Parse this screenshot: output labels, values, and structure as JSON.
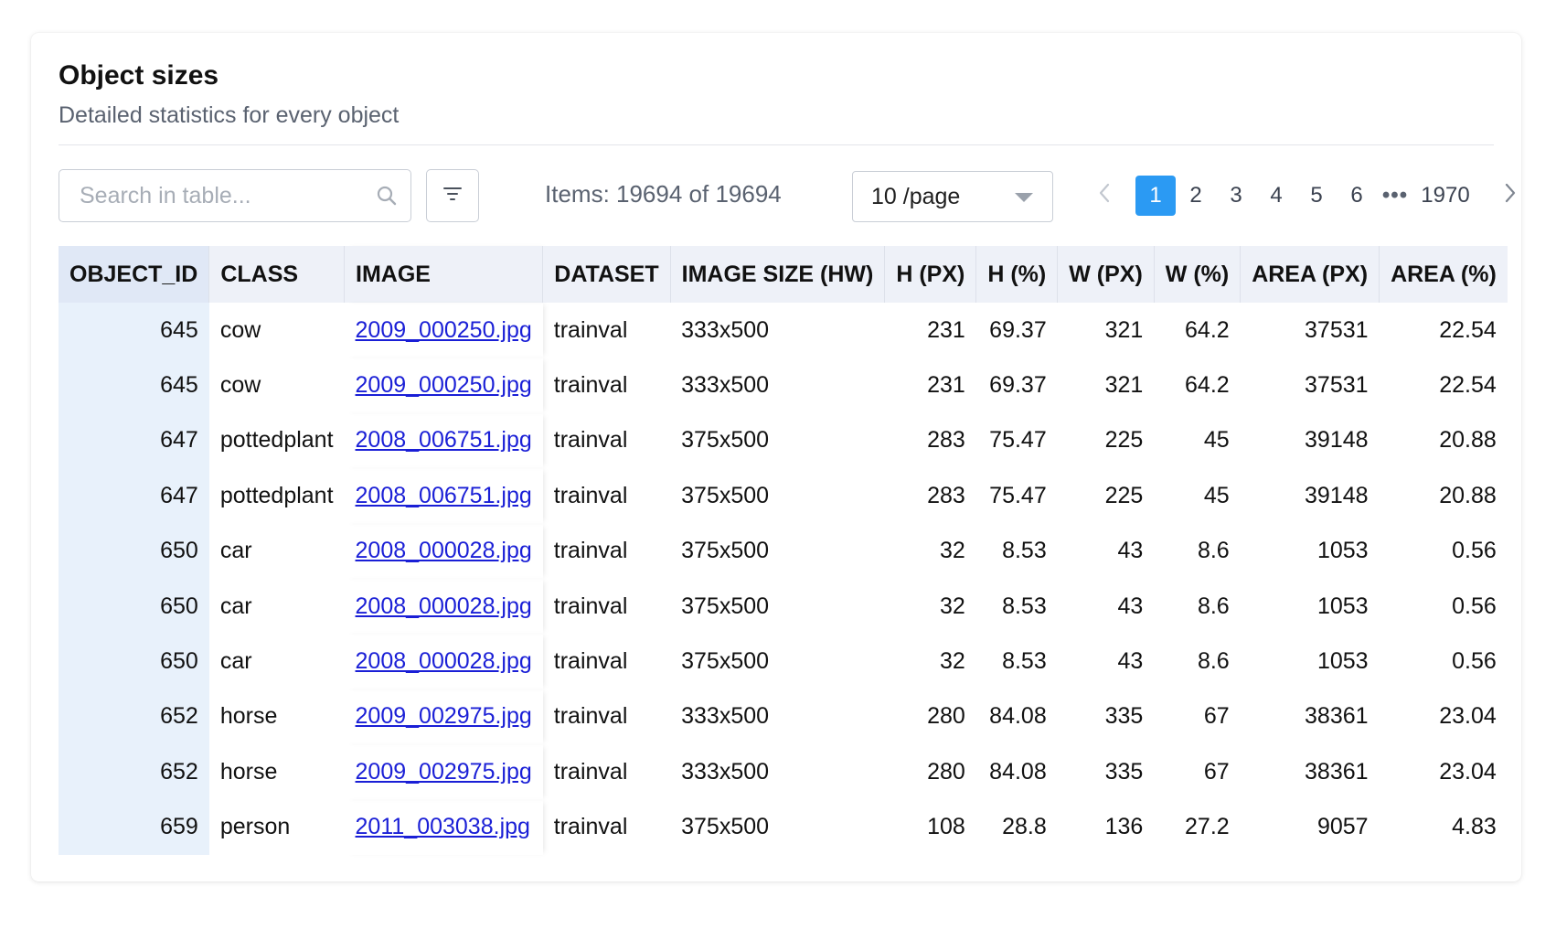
{
  "card": {
    "title": "Object sizes",
    "subtitle": "Detailed statistics for every object"
  },
  "toolbar": {
    "search_placeholder": "Search in table...",
    "search_icon": "search-icon",
    "filter_icon": "filter-icon",
    "items_text": "Items: 19694 of 19694",
    "page_size_label": "10 /page",
    "page_size_icon": "caret-down-icon"
  },
  "pagination": {
    "prev_icon": "chevron-left-icon",
    "pages": [
      "1",
      "2",
      "3",
      "4",
      "5",
      "6"
    ],
    "current_page": "1",
    "ellipsis": "•••",
    "last_page": "1970",
    "next_icon": "chevron-right-icon"
  },
  "table": {
    "columns": [
      "OBJECT_ID",
      "CLASS",
      "IMAGE",
      "DATASET",
      "IMAGE SIZE (HW)",
      "H (PX)",
      "H (%)",
      "W (PX)",
      "W (%)",
      "AREA (PX)",
      "AREA (%)"
    ],
    "rows": [
      [
        "645",
        "cow",
        "2009_000250.jpg",
        "trainval",
        "333x500",
        "231",
        "69.37",
        "321",
        "64.2",
        "37531",
        "22.54"
      ],
      [
        "645",
        "cow",
        "2009_000250.jpg",
        "trainval",
        "333x500",
        "231",
        "69.37",
        "321",
        "64.2",
        "37531",
        "22.54"
      ],
      [
        "647",
        "pottedplant",
        "2008_006751.jpg",
        "trainval",
        "375x500",
        "283",
        "75.47",
        "225",
        "45",
        "39148",
        "20.88"
      ],
      [
        "647",
        "pottedplant",
        "2008_006751.jpg",
        "trainval",
        "375x500",
        "283",
        "75.47",
        "225",
        "45",
        "39148",
        "20.88"
      ],
      [
        "650",
        "car",
        "2008_000028.jpg",
        "trainval",
        "375x500",
        "32",
        "8.53",
        "43",
        "8.6",
        "1053",
        "0.56"
      ],
      [
        "650",
        "car",
        "2008_000028.jpg",
        "trainval",
        "375x500",
        "32",
        "8.53",
        "43",
        "8.6",
        "1053",
        "0.56"
      ],
      [
        "650",
        "car",
        "2008_000028.jpg",
        "trainval",
        "375x500",
        "32",
        "8.53",
        "43",
        "8.6",
        "1053",
        "0.56"
      ],
      [
        "652",
        "horse",
        "2009_002975.jpg",
        "trainval",
        "333x500",
        "280",
        "84.08",
        "335",
        "67",
        "38361",
        "23.04"
      ],
      [
        "652",
        "horse",
        "2009_002975.jpg",
        "trainval",
        "333x500",
        "280",
        "84.08",
        "335",
        "67",
        "38361",
        "23.04"
      ],
      [
        "659",
        "person",
        "2011_003038.jpg",
        "trainval",
        "375x500",
        "108",
        "28.8",
        "136",
        "27.2",
        "9057",
        "4.83"
      ]
    ]
  },
  "colors": {
    "accent": "#2b9af3",
    "link": "#1a1fd6",
    "header_bg": "#eef1f8",
    "first_column_bg": "#e8f1fb"
  }
}
